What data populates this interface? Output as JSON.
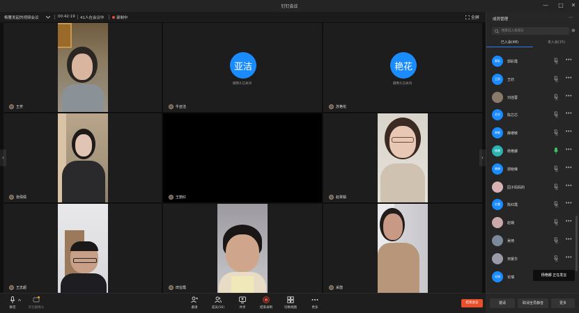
{
  "window": {
    "title": "钉钉会议",
    "minimize": "—",
    "maximize": "□",
    "close": "✕"
  },
  "meeting": {
    "name": "杨雁发起的视频会议",
    "duration": "00:42:19",
    "attendees": "41人在会议中",
    "recording": "录制中",
    "fullscreen": "全屏"
  },
  "tiles": [
    {
      "name": "王芳",
      "type": "video"
    },
    {
      "name": "牛亚洁",
      "type": "avatar",
      "avatar_text": "亚洁",
      "camera_status": "摄像头已关闭"
    },
    {
      "name": "苏艳花",
      "type": "avatar",
      "avatar_text": "艳花",
      "camera_status": "摄像头已关闭"
    },
    {
      "name": "张倩倩",
      "type": "video"
    },
    {
      "name": "王丽红",
      "type": "blank"
    },
    {
      "name": "赵翠娟",
      "type": "video"
    },
    {
      "name": "王志超",
      "type": "video"
    },
    {
      "name": "田宝霞",
      "type": "video"
    },
    {
      "name": "采茵",
      "type": "video"
    }
  ],
  "toolbar": {
    "mute": "静音",
    "camera": "开启摄像头",
    "invite": "邀请",
    "members": "成员(56)",
    "share": "共享",
    "stop_record": "结束录制",
    "layout": "切换视图",
    "more": "更多",
    "end": "结束会议"
  },
  "panel": {
    "title": "成员管理",
    "search_placeholder": "搜索已入会成员",
    "tab_joined": "已入会(48)",
    "tab_not_joined": "未入会(15)",
    "members": [
      {
        "name": "郭彩霞",
        "avatar": "郭彩",
        "color": "#1a8cff"
      },
      {
        "name": "王欣",
        "avatar": "王欣",
        "color": "#1a8cff"
      },
      {
        "name": "刘佳蓉",
        "avatar": "",
        "color": "#8a7a6a"
      },
      {
        "name": "陈芯芯",
        "avatar": "芯芯",
        "color": "#1a8cff"
      },
      {
        "name": "薛继敏",
        "avatar": "继敏",
        "color": "#1a8cff"
      },
      {
        "name": "杨艳娜",
        "avatar": "杨娜",
        "color": "#2bb3b3"
      },
      {
        "name": "郭晓琳",
        "avatar": "晓琳",
        "color": "#1a8cff"
      },
      {
        "name": "园子妈妈的",
        "avatar": "",
        "color": "#d9b3b3"
      },
      {
        "name": "陈红霞",
        "avatar": "红霞",
        "color": "#1a8cff"
      },
      {
        "name": "赵璐",
        "avatar": "",
        "color": "#c9a9a9"
      },
      {
        "name": "吴琦",
        "avatar": "",
        "color": "#7a8a9a"
      },
      {
        "name": "宋媛华",
        "avatar": "",
        "color": "#9a9aa9"
      },
      {
        "name": "论瑞",
        "avatar": "论瑞",
        "color": "#1a8cff"
      }
    ],
    "speaking_name": "杨艳娜",
    "speaking_status": "正在发言",
    "invite": "邀请",
    "unmute_all": "取消全员静音",
    "more": "更多"
  },
  "colors": {
    "accent": "#1a8cff",
    "end_button": "#e8502c",
    "record": "#e84a3a",
    "speaking_mic": "#3cc46a"
  }
}
